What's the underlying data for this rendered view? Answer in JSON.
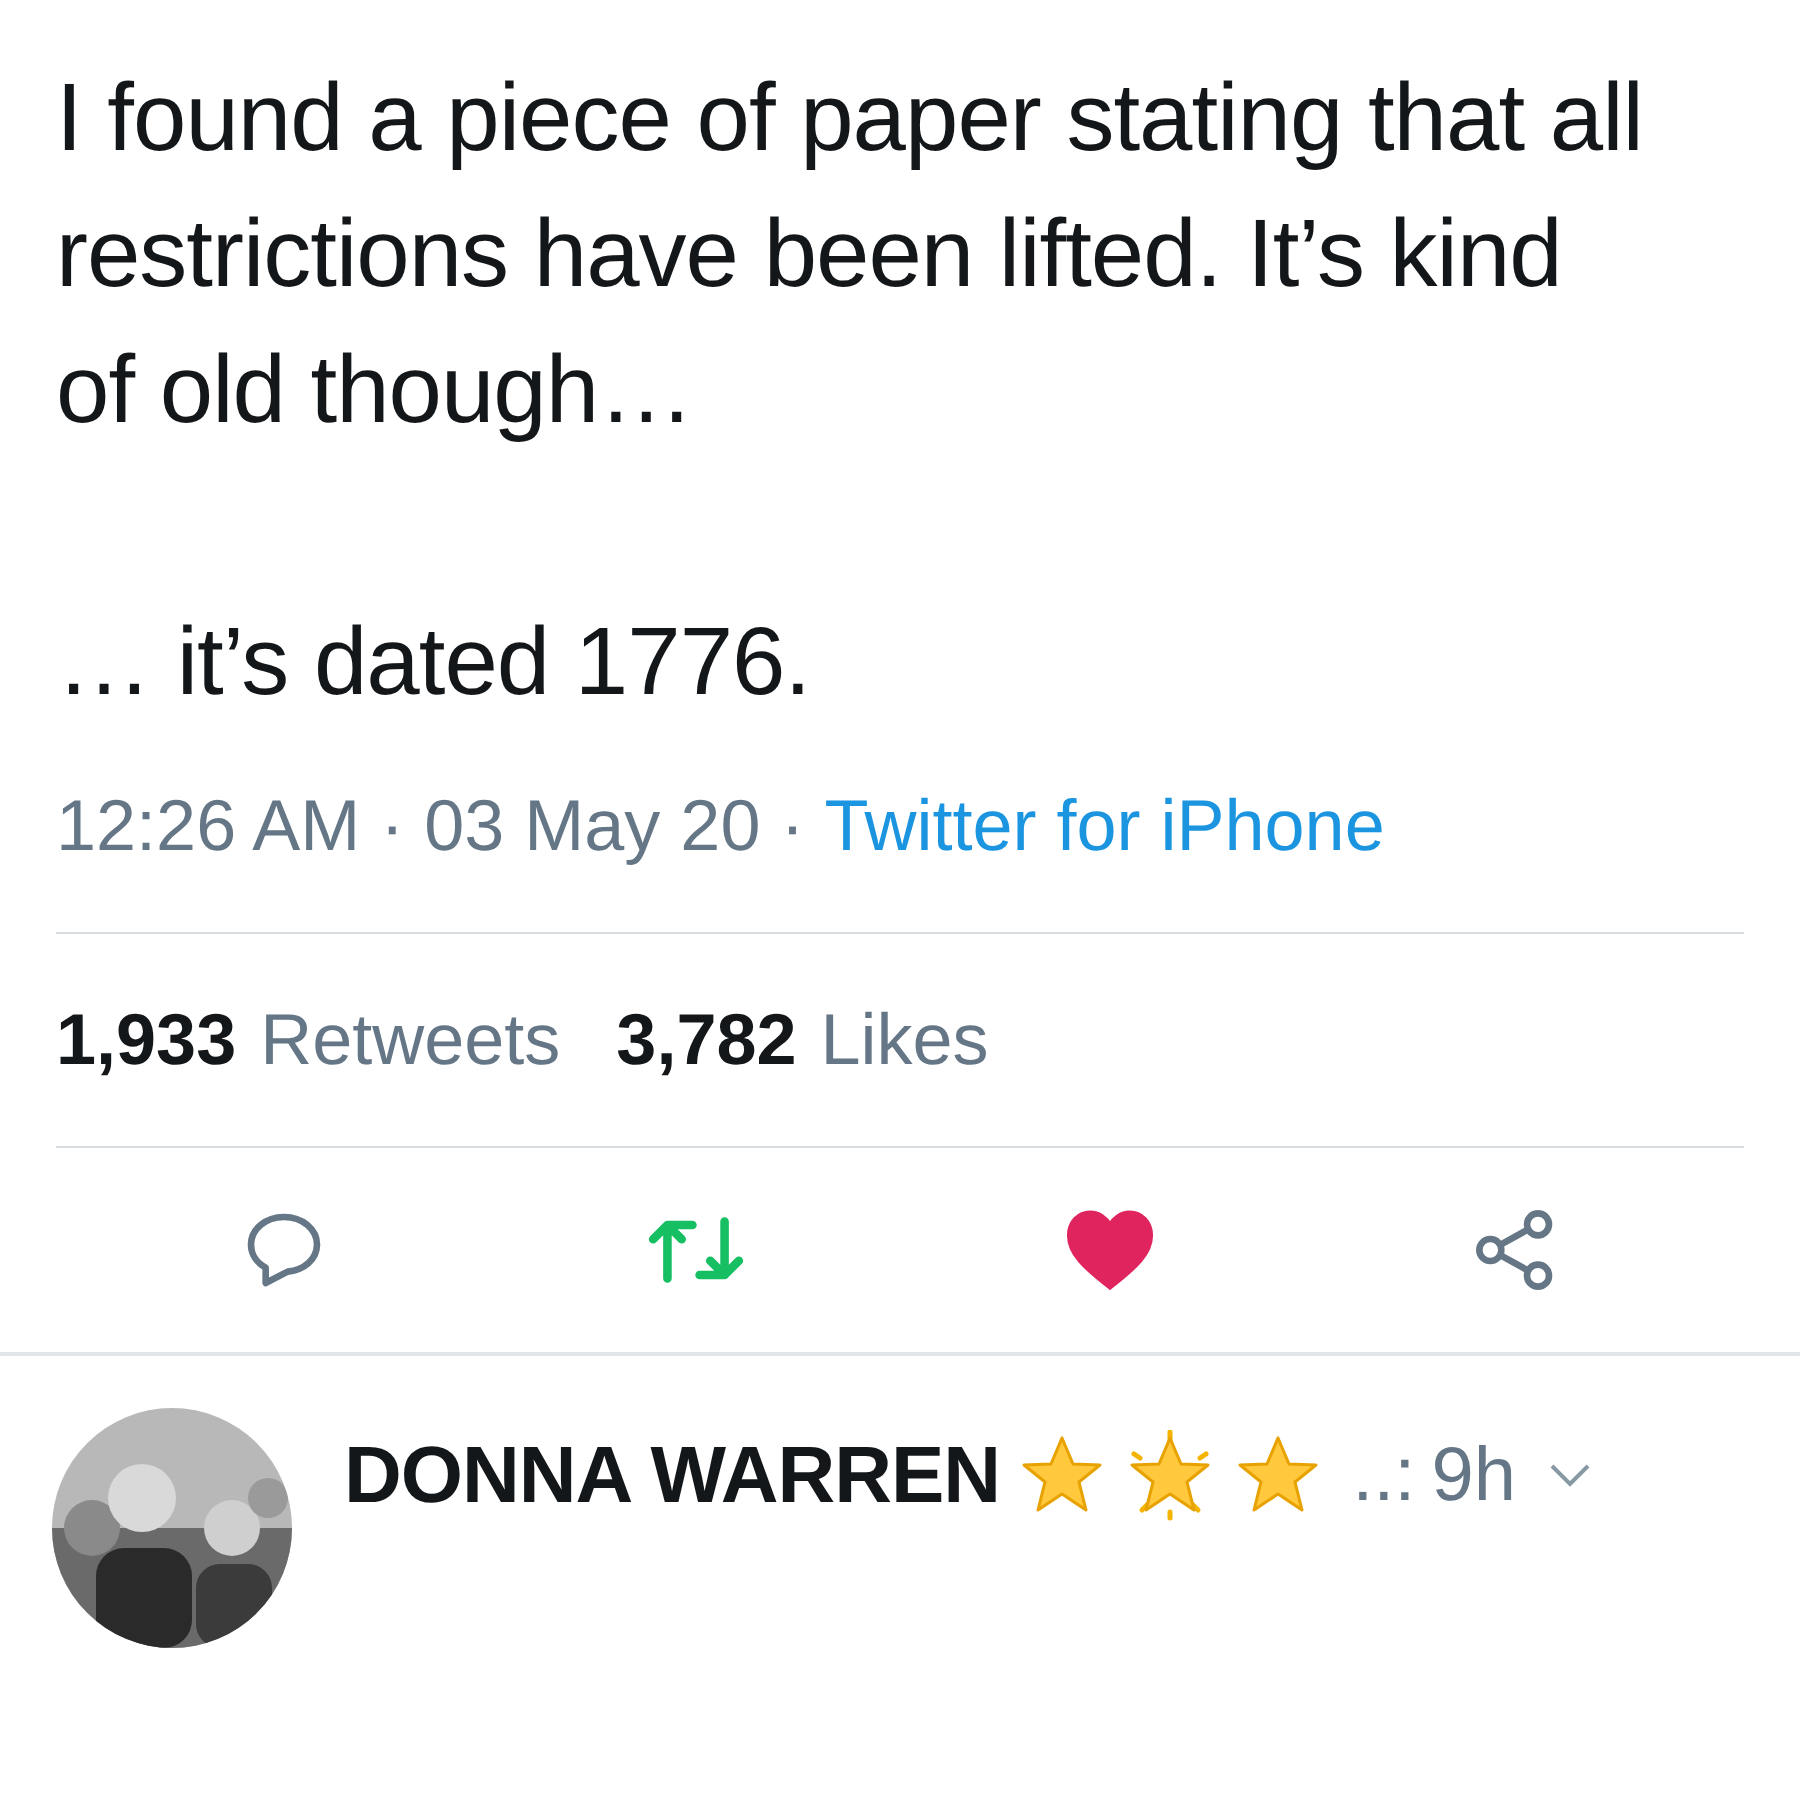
{
  "tweet": {
    "paragraphs": [
      "I found a piece of paper stating that all restrictions have been lifted. It’s kind of old though…",
      "… it’s dated 1776."
    ],
    "time": "12:26 AM",
    "separator": "·",
    "date": "03 May 20",
    "source": "Twitter for iPhone",
    "stats": [
      {
        "count": "1,933",
        "label": "Retweets"
      },
      {
        "count": "3,782",
        "label": "Likes"
      }
    ],
    "retweeted": true,
    "liked": true
  },
  "reply": {
    "name": "DONNA WARREN",
    "handle": "..:",
    "time": "9h"
  }
}
